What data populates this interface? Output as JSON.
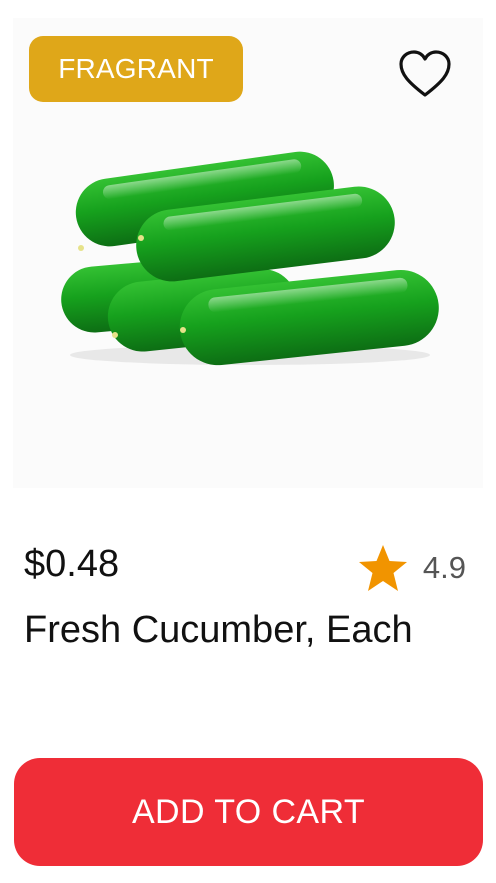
{
  "product": {
    "badge": "FRAGRANT",
    "price": "$0.48",
    "rating": "4.9",
    "name": "Fresh Cucumber, Each"
  },
  "actions": {
    "add_to_cart_label": "ADD TO CART"
  },
  "icons": {
    "favorite": "heart-outline-icon",
    "rating": "star-icon"
  },
  "colors": {
    "badge_bg": "#dfa719",
    "cta_bg": "#ef2d37",
    "star": "#f19400",
    "cucumber": "#16a11d"
  }
}
